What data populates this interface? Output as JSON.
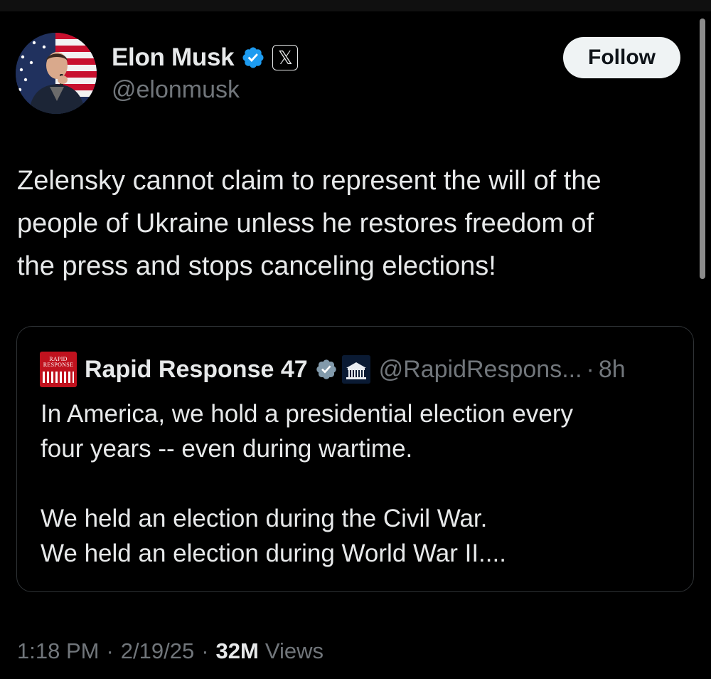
{
  "author": {
    "name": "Elon Musk",
    "handle": "@elonmusk",
    "affiliate_badge": "𝕏"
  },
  "follow_button": {
    "label": "Follow"
  },
  "tweet": {
    "lines": [
      "Zelensky cannot claim to represent the will of the",
      "people of Ukraine unless he restores freedom of",
      "the press and stops canceling elections!"
    ]
  },
  "quoted_tweet": {
    "logo_text": [
      "RAPID",
      "RESPONSE"
    ],
    "name": "Rapid Response 47",
    "handle": "@RapidRespons...",
    "separator": "·",
    "time": "8h",
    "paragraph1": [
      "In America, we hold a presidential election every",
      "four years -- even during wartime."
    ],
    "paragraph2": [
      "We held an election during the Civil War.",
      "We held an election during World War II...."
    ]
  },
  "meta": {
    "time": "1:18 PM",
    "separator": "·",
    "date": "2/19/25",
    "views_count": "32M",
    "views_label": "Views"
  },
  "colors": {
    "background": "#000000",
    "text_primary": "#e7e9ea",
    "text_secondary": "#71767b",
    "verified_blue": "#1d9bf0",
    "verified_gray": "#829aab",
    "border": "#2f3336",
    "follow_bg": "#eff3f4"
  }
}
